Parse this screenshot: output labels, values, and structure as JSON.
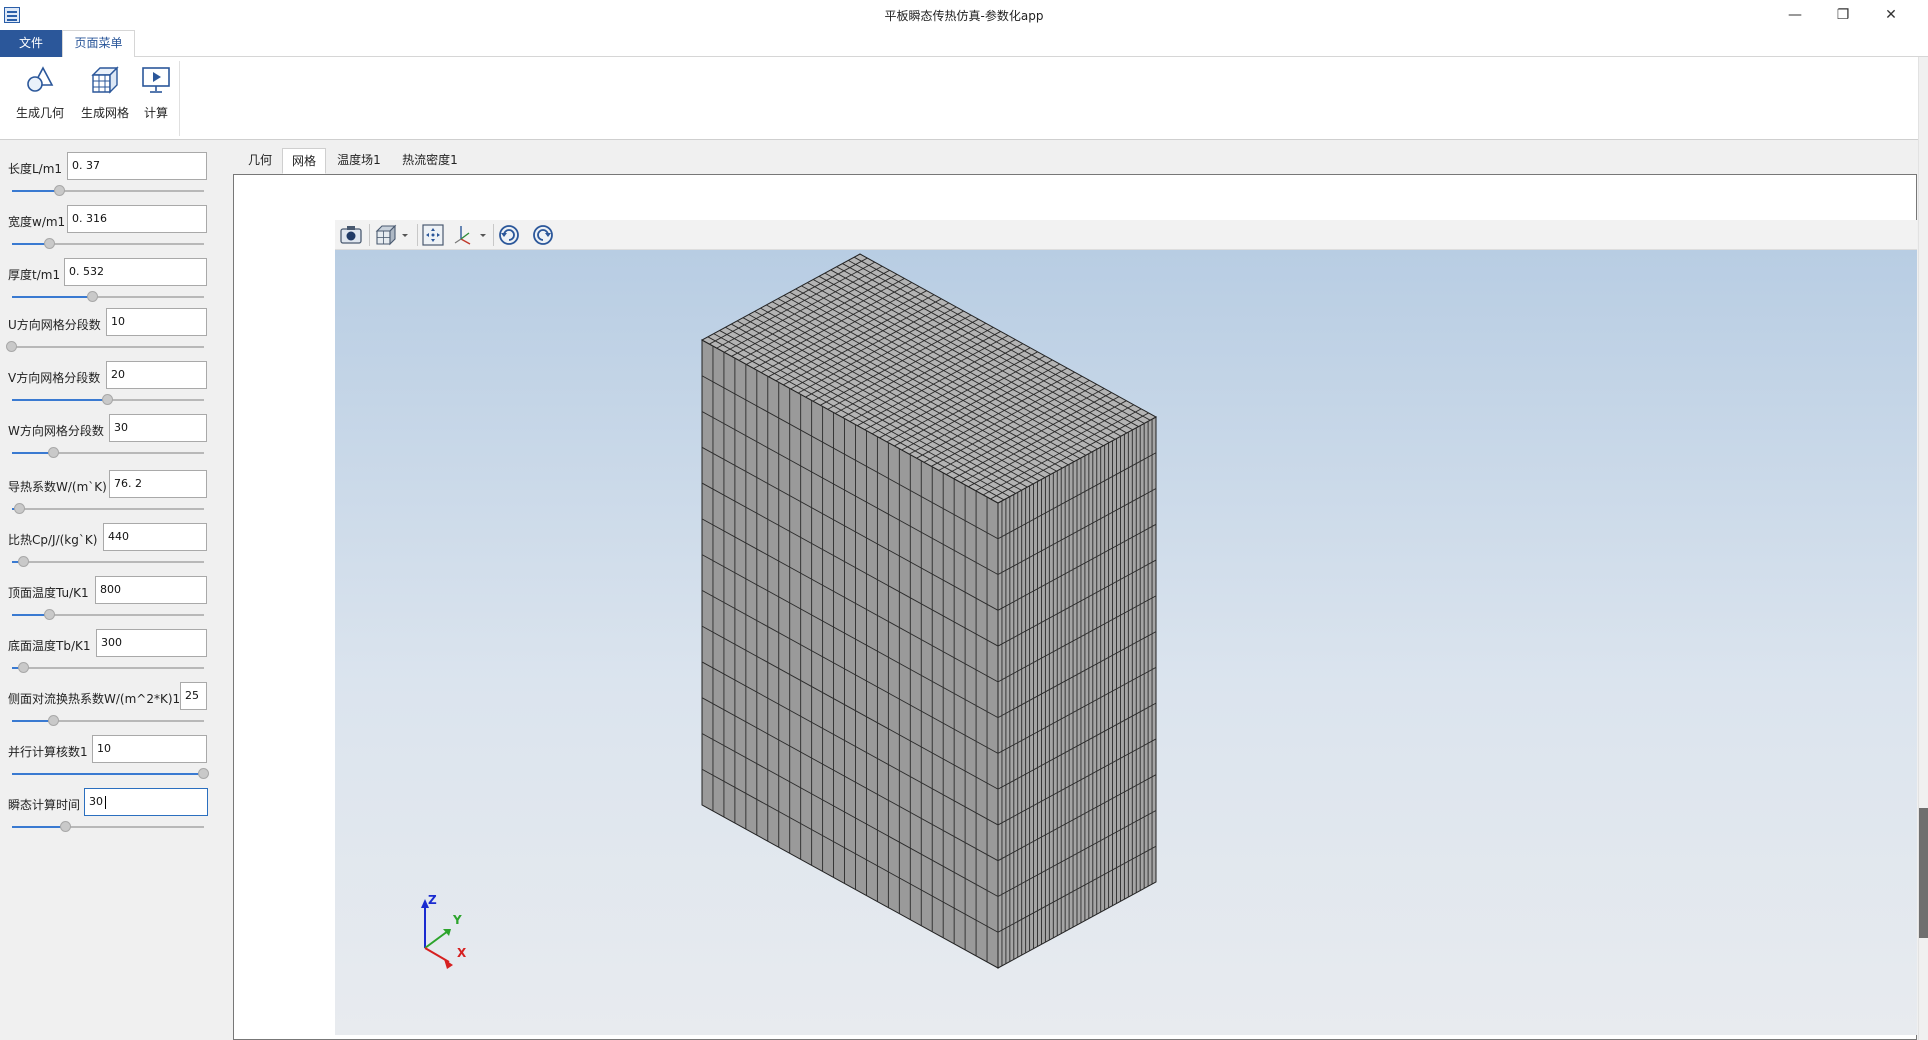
{
  "window": {
    "title": "平板瞬态传热仿真-参数化app",
    "minimize_icon": "minimize-icon",
    "restore_icon": "restore-icon",
    "close_icon": "close-icon"
  },
  "ribbon": {
    "file_tab": "文件",
    "page_tab": "页面菜单",
    "buttons": [
      {
        "label": "生成几何",
        "icon": "geometry-icon"
      },
      {
        "label": "生成网格",
        "icon": "mesh-icon"
      },
      {
        "label": "计算",
        "icon": "compute-icon"
      }
    ]
  },
  "params": [
    {
      "label": "长度L/m1",
      "value": "0. 37",
      "slider": 0.25
    },
    {
      "label": "宽度w/m1",
      "value": "0. 316",
      "slider": 0.2
    },
    {
      "label": "厚度t/m1",
      "value": "0. 532",
      "slider": 0.42
    },
    {
      "label": "U方向网格分段数",
      "value": "10",
      "slider": 0.0
    },
    {
      "label": "V方向网格分段数",
      "value": "20",
      "slider": 0.5
    },
    {
      "label": "W方向网格分段数",
      "value": "30",
      "slider": 0.22
    },
    {
      "label": "导热系数W/(m`K)",
      "value": "76. 2",
      "slider": 0.04
    },
    {
      "label": "比热Cp/J/(kg`K)",
      "value": "440",
      "slider": 0.06
    },
    {
      "label": "顶面温度Tu/K1",
      "value": "800",
      "slider": 0.2
    },
    {
      "label": "底面温度Tb/K1",
      "value": "300",
      "slider": 0.06
    },
    {
      "label": "侧面对流换热系数W/(m^2*K)1",
      "value": "25",
      "slider": 0.22
    },
    {
      "label": "并行计算核数1",
      "value": "10",
      "slider": 1.0
    },
    {
      "label": "瞬态计算时间",
      "value": "30",
      "slider": 0.28
    }
  ],
  "tabs": [
    "几何",
    "网格",
    "温度场1",
    "热流密度1"
  ],
  "active_tab": "网格",
  "viewer_toolbar": [
    "camera-icon",
    "view-cube-icon",
    "fit-view-icon",
    "axes-icon",
    "rotate-left-icon",
    "rotate-right-icon"
  ],
  "axes": {
    "x": "X",
    "y": "Y",
    "z": "Z"
  },
  "mesh": {
    "top_u": 40,
    "top_v": 27,
    "front_cols": 27,
    "side_cols": 40,
    "height_rows": 13
  }
}
